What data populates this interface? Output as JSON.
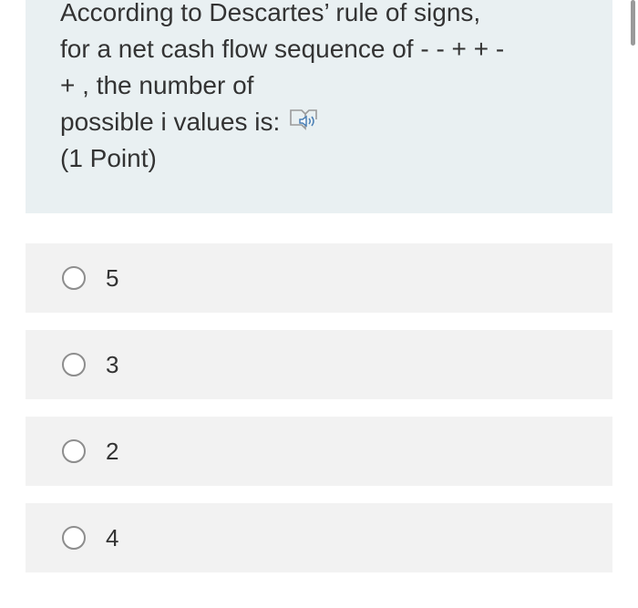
{
  "question": {
    "lines": [
      "According to Descartes’ rule of signs,",
      "for a net cash flow sequence of - - + + -",
      "+  , the number of",
      "possible i values is:"
    ],
    "points": "(1 Point)",
    "speaker_icon": "immersive-reader-speaker-icon"
  },
  "options": [
    {
      "label": "5",
      "selected": false
    },
    {
      "label": "3",
      "selected": false
    },
    {
      "label": "2",
      "selected": false
    },
    {
      "label": "4",
      "selected": false
    }
  ],
  "colors": {
    "question_background": "#e9f0f2",
    "option_background": "#f2f2f2",
    "text": "#333333",
    "radio_border": "#8d8d8d",
    "scrollbar": "#9a9a9a"
  }
}
